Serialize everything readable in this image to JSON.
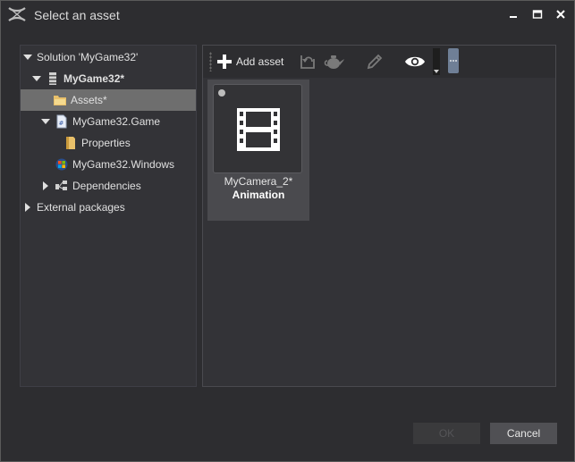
{
  "window": {
    "title": "Select an asset"
  },
  "title_buttons": {
    "minimize_icon": "minimize-icon",
    "maximize_icon": "maximize-icon",
    "close_icon": "close-icon"
  },
  "tree": {
    "items": [
      {
        "label": "Solution 'MyGame32'",
        "expanded": true,
        "icon": "none"
      },
      {
        "label": "MyGame32*",
        "expanded": true,
        "icon": "package-icon",
        "bold": true
      },
      {
        "label": "Assets*",
        "icon": "folder-icon",
        "selected": true
      },
      {
        "label": "MyGame32.Game",
        "expanded": true,
        "icon": "csharp-file-icon"
      },
      {
        "label": "Properties",
        "icon": "folder-icon"
      },
      {
        "label": "MyGame32.Windows",
        "icon": "windows-icon"
      },
      {
        "label": "Dependencies",
        "expanded": false,
        "icon": "dependencies-icon"
      },
      {
        "label": "External packages",
        "expanded": false,
        "icon": "none"
      }
    ]
  },
  "toolbar": {
    "add_label": "Add asset",
    "icons": [
      "plus-icon",
      "undo-icon",
      "teapot-icon",
      "pencil-icon",
      "eye-icon",
      "more-icon"
    ]
  },
  "assets": [
    {
      "name": "MyCamera_2*",
      "type": "Animation",
      "icon": "film-icon"
    }
  ],
  "footer": {
    "ok_label": "OK",
    "cancel_label": "Cancel"
  },
  "colors": {
    "background": "#2d2d30",
    "panel": "#333337",
    "selected": "#6e6e6e",
    "accent": "#6f7f96"
  }
}
